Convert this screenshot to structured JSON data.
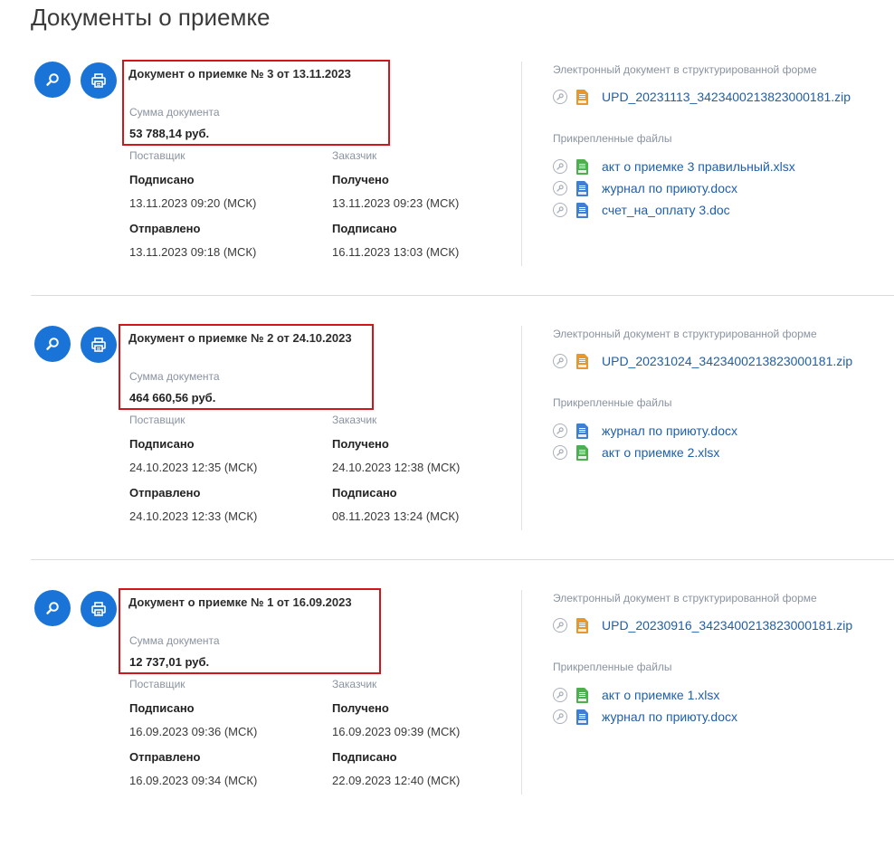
{
  "page": {
    "title": "Документы о приемке"
  },
  "labels": {
    "sum": "Сумма документа",
    "supplier": "Поставщик",
    "customer": "Заказчик",
    "signed": "Подписано",
    "received": "Получено",
    "sent": "Отправлено",
    "e_doc": "Электронный документ в структурированной форме",
    "attached": "Прикрепленные файлы"
  },
  "icons": {
    "search": "search-icon",
    "print": "print-icon",
    "signature": "signature-icon",
    "zip": "zip-file-icon",
    "xlsx": "xlsx-file-icon",
    "docx": "docx-file-icon"
  },
  "colors": {
    "accent": "#1a73d6",
    "highlight": "#d0161a",
    "link": "#1f5fa8",
    "zip": "#e8962e",
    "xlsx": "#4caf50",
    "docx": "#3f7fd1"
  },
  "documents": [
    {
      "title": "Документ о приемке № 3 от 13.11.2023",
      "sum": "53 788,14 руб.",
      "supplier_signed": "13.11.2023 09:20 (МСК)",
      "customer_received": "13.11.2023 09:23 (МСК)",
      "supplier_sent": "13.11.2023 09:18 (МСК)",
      "customer_signed": "16.11.2023 13:03 (МСК)",
      "e_doc_file": "UPD_20231113_3423400213823000181.zip",
      "attachments": [
        {
          "name": "акт о приемке 3 правильный.xlsx",
          "type": "xlsx"
        },
        {
          "name": "журнал по приюту.docx",
          "type": "docx"
        },
        {
          "name": "счет_на_оплату 3.doc",
          "type": "docx"
        }
      ]
    },
    {
      "title": "Документ о приемке № 2 от 24.10.2023",
      "sum": "464 660,56 руб.",
      "supplier_signed": "24.10.2023 12:35 (МСК)",
      "customer_received": "24.10.2023 12:38 (МСК)",
      "supplier_sent": "24.10.2023 12:33 (МСК)",
      "customer_signed": "08.11.2023 13:24 (МСК)",
      "e_doc_file": "UPD_20231024_3423400213823000181.zip",
      "attachments": [
        {
          "name": "журнал по приюту.docx",
          "type": "docx"
        },
        {
          "name": "акт о приемке 2.xlsx",
          "type": "xlsx"
        }
      ]
    },
    {
      "title": "Документ о приемке № 1 от 16.09.2023",
      "sum": "12 737,01 руб.",
      "supplier_signed": "16.09.2023 09:36 (МСК)",
      "customer_received": "16.09.2023 09:39 (МСК)",
      "supplier_sent": "16.09.2023 09:34 (МСК)",
      "customer_signed": "22.09.2023 12:40 (МСК)",
      "e_doc_file": "UPD_20230916_3423400213823000181.zip",
      "attachments": [
        {
          "name": "акт о приемке 1.xlsx",
          "type": "xlsx"
        },
        {
          "name": "журнал по приюту.docx",
          "type": "docx"
        }
      ]
    }
  ]
}
